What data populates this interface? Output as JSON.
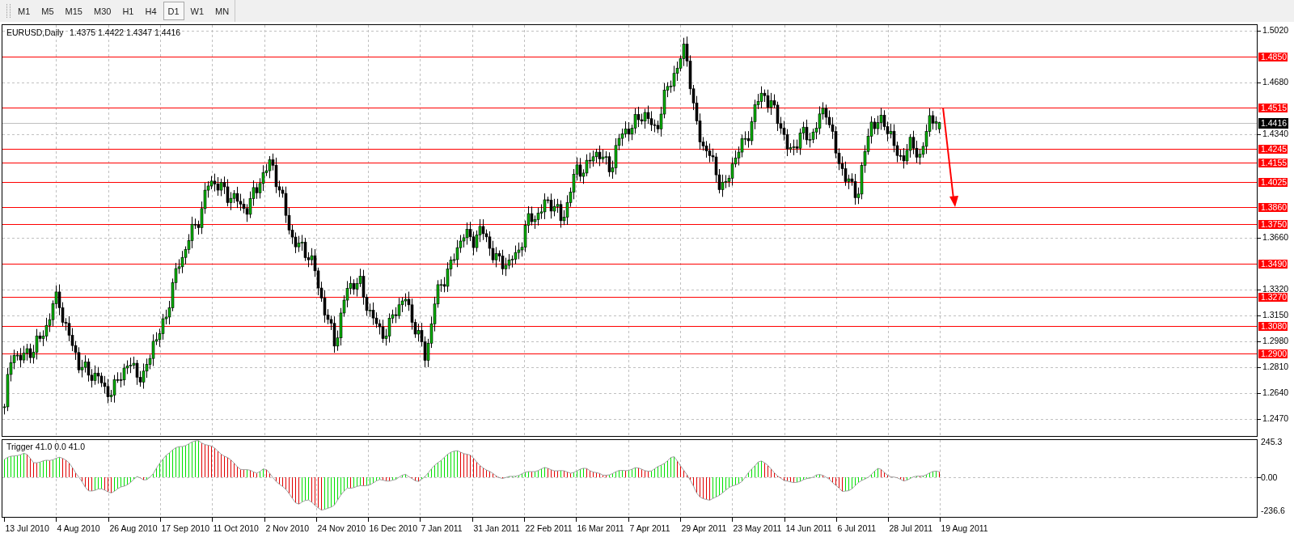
{
  "toolbar": {
    "timeframes": [
      {
        "label": "M1",
        "selected": false
      },
      {
        "label": "M5",
        "selected": false
      },
      {
        "label": "M15",
        "selected": false
      },
      {
        "label": "M30",
        "selected": false
      },
      {
        "label": "H1",
        "selected": false
      },
      {
        "label": "H4",
        "selected": false
      },
      {
        "label": "D1",
        "selected": true
      },
      {
        "label": "W1",
        "selected": false
      },
      {
        "label": "MN",
        "selected": false
      }
    ]
  },
  "chart": {
    "title": "EURUSD,Daily",
    "ohlc": "1.4375 1.4422 1.4347 1.4416",
    "price_axis": {
      "ticks": [
        "1.5020",
        "1.4680",
        "1.4340",
        "1.3660",
        "1.3320",
        "1.3150",
        "1.2980",
        "1.2810",
        "1.2640",
        "1.2470"
      ]
    },
    "current_price": "1.4416",
    "levels": [
      {
        "label": "1.4850"
      },
      {
        "label": "1.4515"
      },
      {
        "label": "1.4245"
      },
      {
        "label": "1.4155"
      },
      {
        "label": "1.4025"
      },
      {
        "label": "1.3860"
      },
      {
        "label": "1.3750"
      },
      {
        "label": "1.3490"
      },
      {
        "label": "1.3270"
      },
      {
        "label": "1.3080"
      },
      {
        "label": "1.2900"
      }
    ],
    "indicator": {
      "title": "Trigger 41.0 0.0 41.0",
      "axis": [
        "245.3",
        "0.00",
        "-236.6"
      ]
    },
    "time_axis": {
      "labels": [
        "13 Jul 2010",
        "4 Aug 2010",
        "26 Aug 2010",
        "17 Sep 2010",
        "11 Oct 2010",
        "2 Nov 2010",
        "24 Nov 2010",
        "16 Dec 2010",
        "7 Jan 2011",
        "31 Jan 2011",
        "22 Feb 2011",
        "16 Mar 2011",
        "7 Apr 2011",
        "29 Apr 2011",
        "23 May 2011",
        "14 Jun 2011",
        "6 Jul 2011",
        "28 Jul 2011",
        "19 Aug 2011"
      ]
    }
  }
}
